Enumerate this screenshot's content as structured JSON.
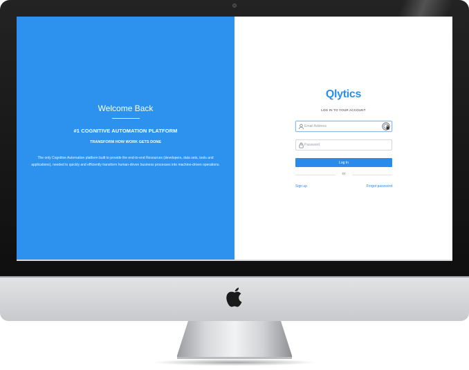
{
  "device": {
    "logo_icon": "apple-logo-icon"
  },
  "left_panel": {
    "background": "#2d92ee",
    "welcome_title": "Welcome Back",
    "tagline": "#1 COGNITIVE AUTOMATION PLATFORM",
    "subtagline": "TRANSFORM HOW WORK GETS DONE",
    "description": "The only Cognitive Automation platform built to provide the end-to-end Resources (developers, data sets, tools and applications), needed to quickly and efficiently transform human-driven business processes into machine-driven operations."
  },
  "login": {
    "brand": "Qlytics",
    "brand_color": "#2a8fe8",
    "heading": "LOG IN TO YOUR ACCOUNT",
    "email": {
      "placeholder": "Email Address",
      "value": "",
      "icon": "user-icon"
    },
    "password": {
      "placeholder": "Password",
      "value": "",
      "icon": "lock-icon"
    },
    "password_manager_icon": "password-manager-icon",
    "button_label": "Log In",
    "divider_text": "or",
    "signup_label": "Sign up",
    "forgot_label": "Forgot password",
    "accent": "#2a8bea"
  }
}
